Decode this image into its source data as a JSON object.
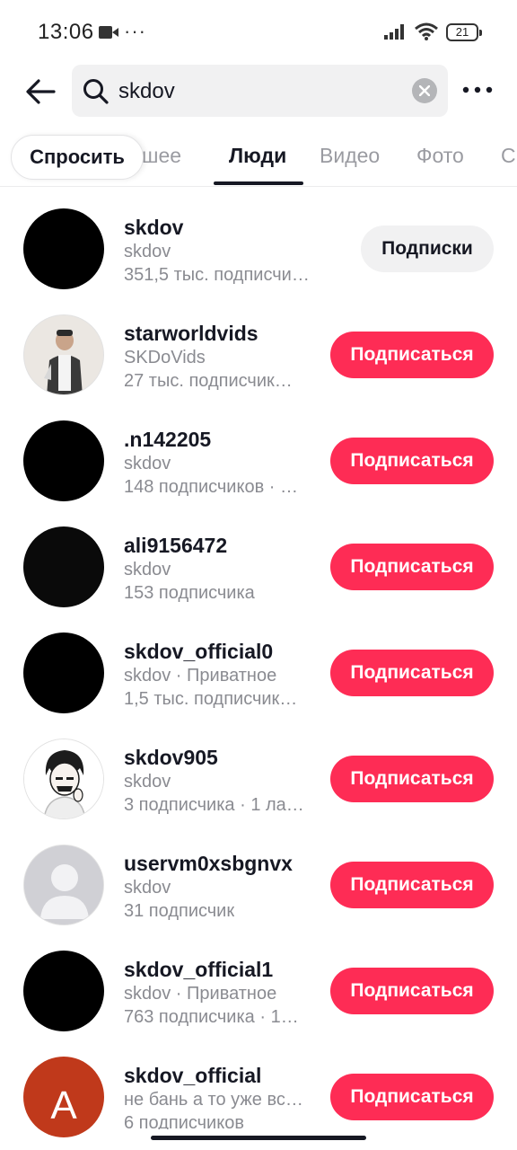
{
  "status_bar": {
    "time": "13:06",
    "notification_dots": "···",
    "battery": "21"
  },
  "search": {
    "query": "skdov"
  },
  "tabs": {
    "ask_label": "Спросить",
    "items": [
      {
        "label": "шее",
        "active": false
      },
      {
        "label": "Люди",
        "active": true
      },
      {
        "label": "Видео",
        "active": false
      },
      {
        "label": "Фото",
        "active": false
      },
      {
        "label": "С",
        "active": false
      }
    ]
  },
  "users": [
    {
      "name": "skdov",
      "sub": "skdov",
      "meta": "351,5 тыс. подписчико…",
      "button": "Подписки",
      "avatar": "black"
    },
    {
      "name": "starworldvids",
      "sub": "SKDoVids",
      "meta": "27 тыс. подписчик…",
      "button": "Подписаться",
      "avatar": "photo"
    },
    {
      "name": ".n142205",
      "sub": "skdov",
      "meta": "148 подписчиков · …",
      "button": "Подписаться",
      "avatar": "black"
    },
    {
      "name": "ali9156472",
      "sub": "skdov",
      "meta": "153 подписчика",
      "button": "Подписаться",
      "avatar": "black"
    },
    {
      "name": "skdov_official0",
      "sub": "skdov · Приватное",
      "meta": "1,5 тыс. подписчик…",
      "button": "Подписаться",
      "avatar": "black"
    },
    {
      "name": "skdov905",
      "sub": "skdov",
      "meta": "3 подписчика · 1 ла…",
      "button": "Подписаться",
      "avatar": "drawing"
    },
    {
      "name": "uservm0xsbgnvx",
      "sub": "skdov",
      "meta": "31 подписчик",
      "button": "Подписаться",
      "avatar": "default"
    },
    {
      "name": "skdov_official1",
      "sub": "skdov · Приватное",
      "meta": "763 подписчика · 1…",
      "button": "Подписаться",
      "avatar": "black"
    },
    {
      "name": "skdov_official",
      "sub": "не бань а то уже вс…",
      "meta": "6 подписчиков",
      "button": "Подписаться",
      "avatar": "letter",
      "avatar_letter": "A"
    }
  ],
  "colors": {
    "accent": "#fe2c55",
    "secondary_button": "#f1f1f2",
    "text": "#161823",
    "muted_text": "#8a8b91"
  }
}
